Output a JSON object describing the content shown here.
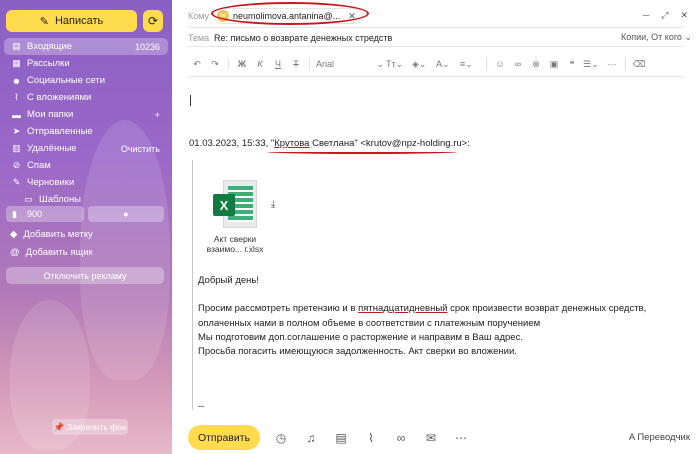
{
  "sidebar": {
    "compose_label": "Написать",
    "folders": [
      {
        "label": "Входящие",
        "count": "10236",
        "icon": "inbox-icon"
      },
      {
        "label": "Рассылки",
        "icon": "newsletters-icon"
      },
      {
        "label": "Социальные сети",
        "icon": "social-icon"
      },
      {
        "label": "С вложениями",
        "icon": "paperclip-icon"
      },
      {
        "label": "Мои папки",
        "icon": "folder-icon"
      },
      {
        "label": "Отправленные",
        "icon": "sent-icon"
      },
      {
        "label": "Удалённые",
        "action": "Очистить",
        "icon": "trash-icon"
      },
      {
        "label": "Спам",
        "icon": "spam-icon"
      },
      {
        "label": "Черновики",
        "icon": "drafts-icon"
      },
      {
        "label": "Шаблоны",
        "icon": "templates-icon"
      }
    ],
    "bookmark_count": "900",
    "add_label": "Добавить метку",
    "add_mailbox": "Добавить ящик",
    "disable_ads": "Отключить рекламу",
    "pin_background": "Закрепить фон"
  },
  "compose": {
    "to_label": "Кому",
    "recipient": "neumolimova.antanina@...",
    "subject_label": "Тема",
    "subject": "Re: письмо о возврате денежных стредств",
    "copies_label": "Копии, От кого",
    "font_name": "Arial",
    "quote_header_prefix": "01.03.2023, 15:33, \"",
    "quote_sender_name": "Крутова",
    "quote_header_rest": " Светлана\" <krutov@npz-holding.ru>:",
    "attachment_line1": "Акт сверки",
    "attachment_line2": "взаимо... г.xlsx",
    "greeting": "Добрый день!",
    "para1_a": "Просим рассмотреть претензию и в ",
    "para1_u": "пятнадцатидневный",
    "para1_b": " срок произвести возврат денежных средств,",
    "para2": "оплаченных нами в полном объеме в соответствии с платежным поручением",
    "para3": "Мы подготовим доп.соглашение о расторжение и направим в Ваш адрес.",
    "para4": "Просьба погасить имеющуюся задолженность. Акт сверки во вложении.",
    "signature_sep": "--",
    "send_label": "Отправить",
    "translator_label": "Переводчик"
  },
  "colors": {
    "accent": "#ffdb4d",
    "annotation": "#c4181e",
    "excel": "#107c41"
  }
}
